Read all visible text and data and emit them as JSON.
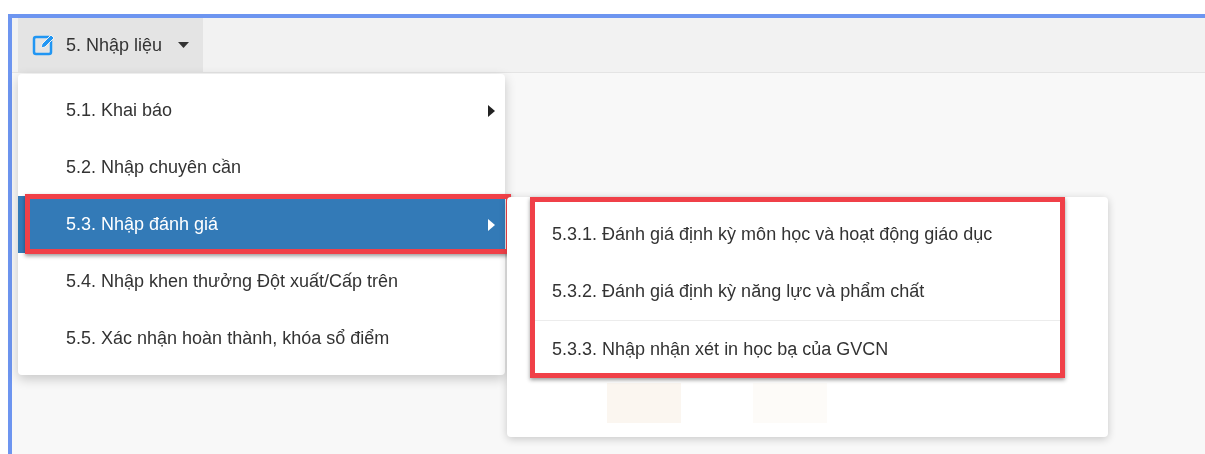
{
  "toolbar": {
    "menu_button": {
      "label": "5. Nhập liệu",
      "expanded": true
    }
  },
  "menu": {
    "items": [
      {
        "label": "5.1. Khai báo",
        "has_submenu": true,
        "selected": false,
        "highlighted": false
      },
      {
        "label": "5.2. Nhập chuyên cần",
        "has_submenu": false,
        "selected": false,
        "highlighted": false
      },
      {
        "label": "5.3. Nhập đánh giá",
        "has_submenu": true,
        "selected": true,
        "highlighted": true
      },
      {
        "label": "5.4. Nhập khen thưởng Đột xuất/Cấp trên",
        "has_submenu": false,
        "selected": false,
        "highlighted": false
      },
      {
        "label": "5.5. Xác nhận hoàn thành, khóa sổ điểm",
        "has_submenu": false,
        "selected": false,
        "highlighted": false
      }
    ]
  },
  "submenu": {
    "highlighted": true,
    "items": [
      {
        "label": "5.3.1. Đánh giá định kỳ môn học và hoạt động giáo dục"
      },
      {
        "label": "5.3.2. Đánh giá định kỳ năng lực và phẩm chất"
      },
      {
        "label": "5.3.3. Nhập nhận xét in học bạ của GVCN"
      }
    ]
  }
}
